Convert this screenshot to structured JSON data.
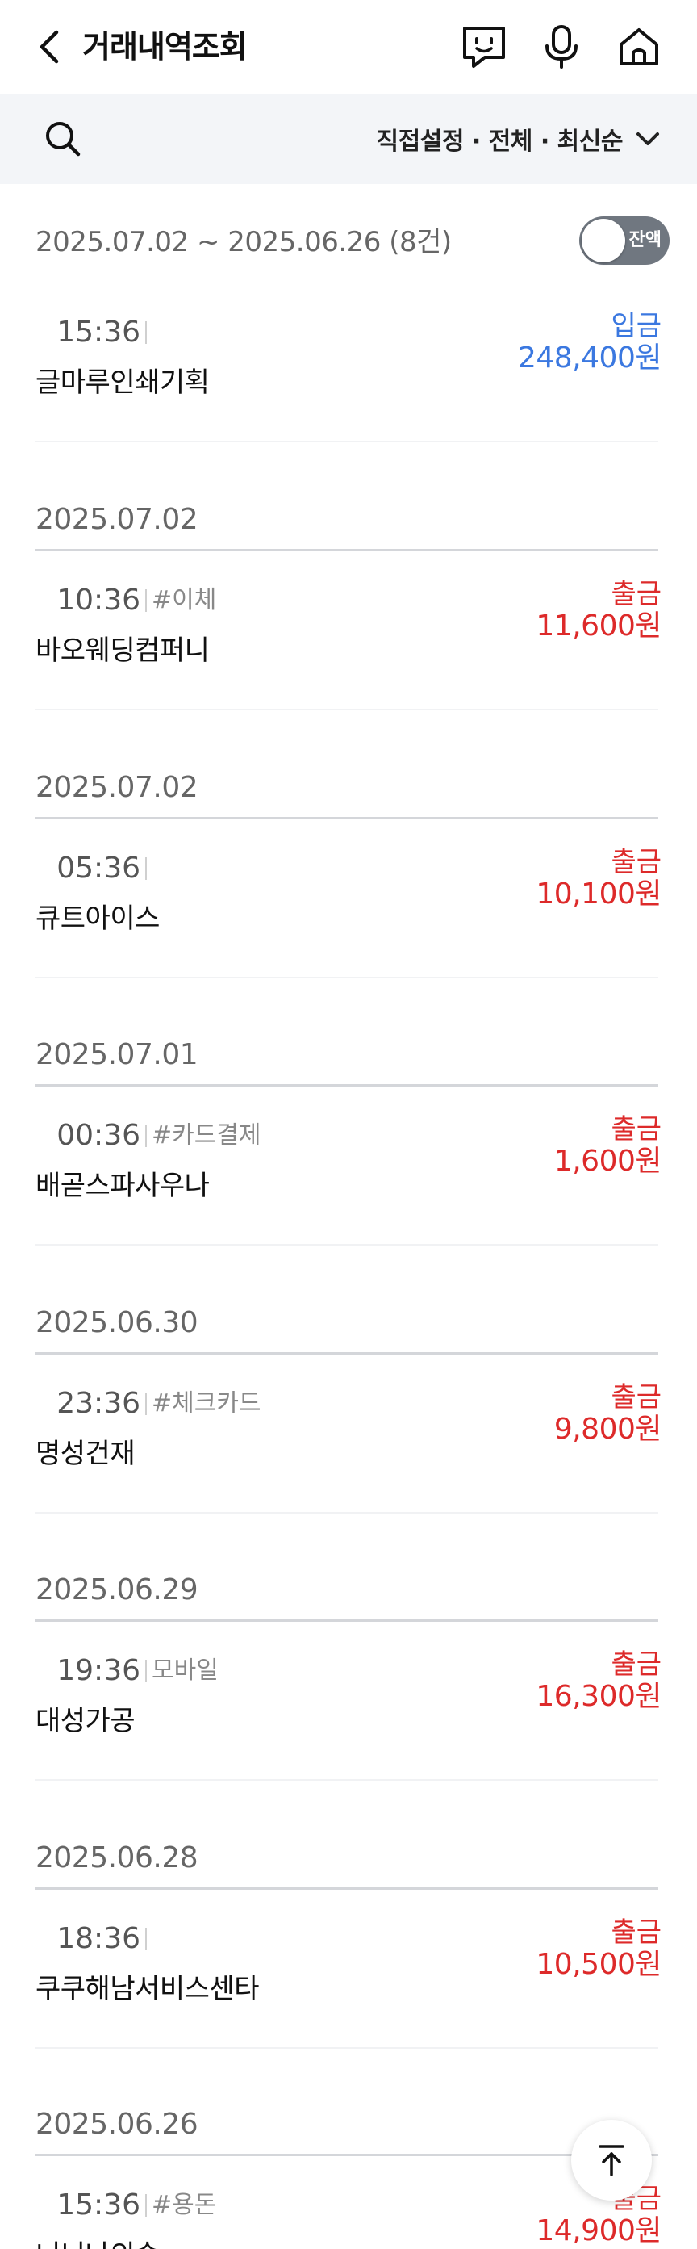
{
  "header": {
    "title": "거래내역조회"
  },
  "filter": {
    "summary": "직접설정 · 전체 · 최신순"
  },
  "summary": {
    "range": "2025.07.02 ~ 2025.06.26 (8건)",
    "balance_label": "잔액",
    "balance_toggle_on": false
  },
  "colors": {
    "deposit": "#3b78e0",
    "withdraw": "#dd2a2a"
  },
  "transactions": [
    {
      "time": "15:36",
      "memo": "",
      "name": "글마루인쇄기획",
      "type": "입금",
      "amount": "248,400원"
    },
    {
      "date": "2025.07.02",
      "time": "10:36",
      "memo": "#이체",
      "name": "바오웨딩컴퍼니",
      "type": "출금",
      "amount": "11,600원"
    },
    {
      "date": "2025.07.02",
      "time": "05:36",
      "memo": "",
      "name": "큐트아이스",
      "type": "출금",
      "amount": "10,100원"
    },
    {
      "date": "2025.07.01",
      "time": "00:36",
      "memo": "#카드결제",
      "name": "배곧스파사우나",
      "type": "출금",
      "amount": "1,600원"
    },
    {
      "date": "2025.06.30",
      "time": "23:36",
      "memo": "#체크카드",
      "name": "명성건재",
      "type": "출금",
      "amount": "9,800원"
    },
    {
      "date": "2025.06.29",
      "time": "19:36",
      "memo": "모바일",
      "name": "대성가공",
      "type": "출금",
      "amount": "16,300원"
    },
    {
      "date": "2025.06.28",
      "time": "18:36",
      "memo": "",
      "name": "쿠쿠해남서비스센타",
      "type": "출금",
      "amount": "10,500원"
    },
    {
      "date": "2025.06.26",
      "time": "15:36",
      "memo": "#용돈",
      "name": "너늬나의숲",
      "type": "출금",
      "amount": "14,900원"
    }
  ]
}
